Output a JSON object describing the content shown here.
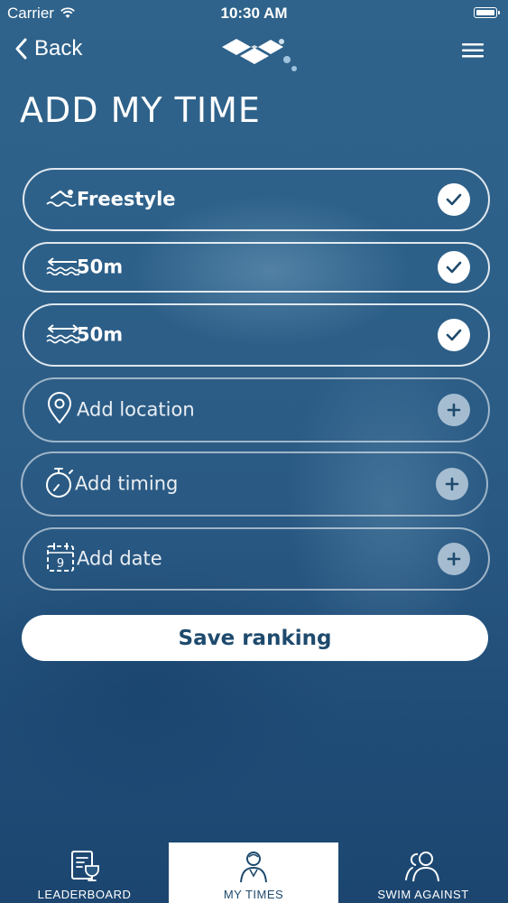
{
  "status_bar": {
    "carrier": "Carrier",
    "time": "10:30 AM"
  },
  "nav": {
    "back_label": "Back"
  },
  "page": {
    "title": "ADD MY TIME"
  },
  "rows": [
    {
      "label": "Freestyle",
      "icon": "swimmer-icon",
      "state": "checked"
    },
    {
      "label": "50m",
      "icon": "pool-length-icon",
      "state": "checked"
    },
    {
      "label": "50m",
      "icon": "distance-icon",
      "state": "checked"
    },
    {
      "label": "Add location",
      "icon": "location-pin-icon",
      "state": "add"
    },
    {
      "label": "Add timing",
      "icon": "stopwatch-icon",
      "state": "add"
    },
    {
      "label": "Add date",
      "icon": "calendar-icon",
      "icon_text": "9",
      "state": "add"
    }
  ],
  "save_label": "Save ranking",
  "tabs": [
    {
      "label": "LEADERBOARD",
      "icon": "trophy-icon"
    },
    {
      "label": "MY TIMES",
      "icon": "swimmer-profile-icon",
      "active": true
    },
    {
      "label": "SWIM AGAINST",
      "icon": "users-icon"
    }
  ],
  "colors": {
    "background": "#2b5d85",
    "accent_text": "#1e4a6d",
    "white": "#ffffff"
  }
}
